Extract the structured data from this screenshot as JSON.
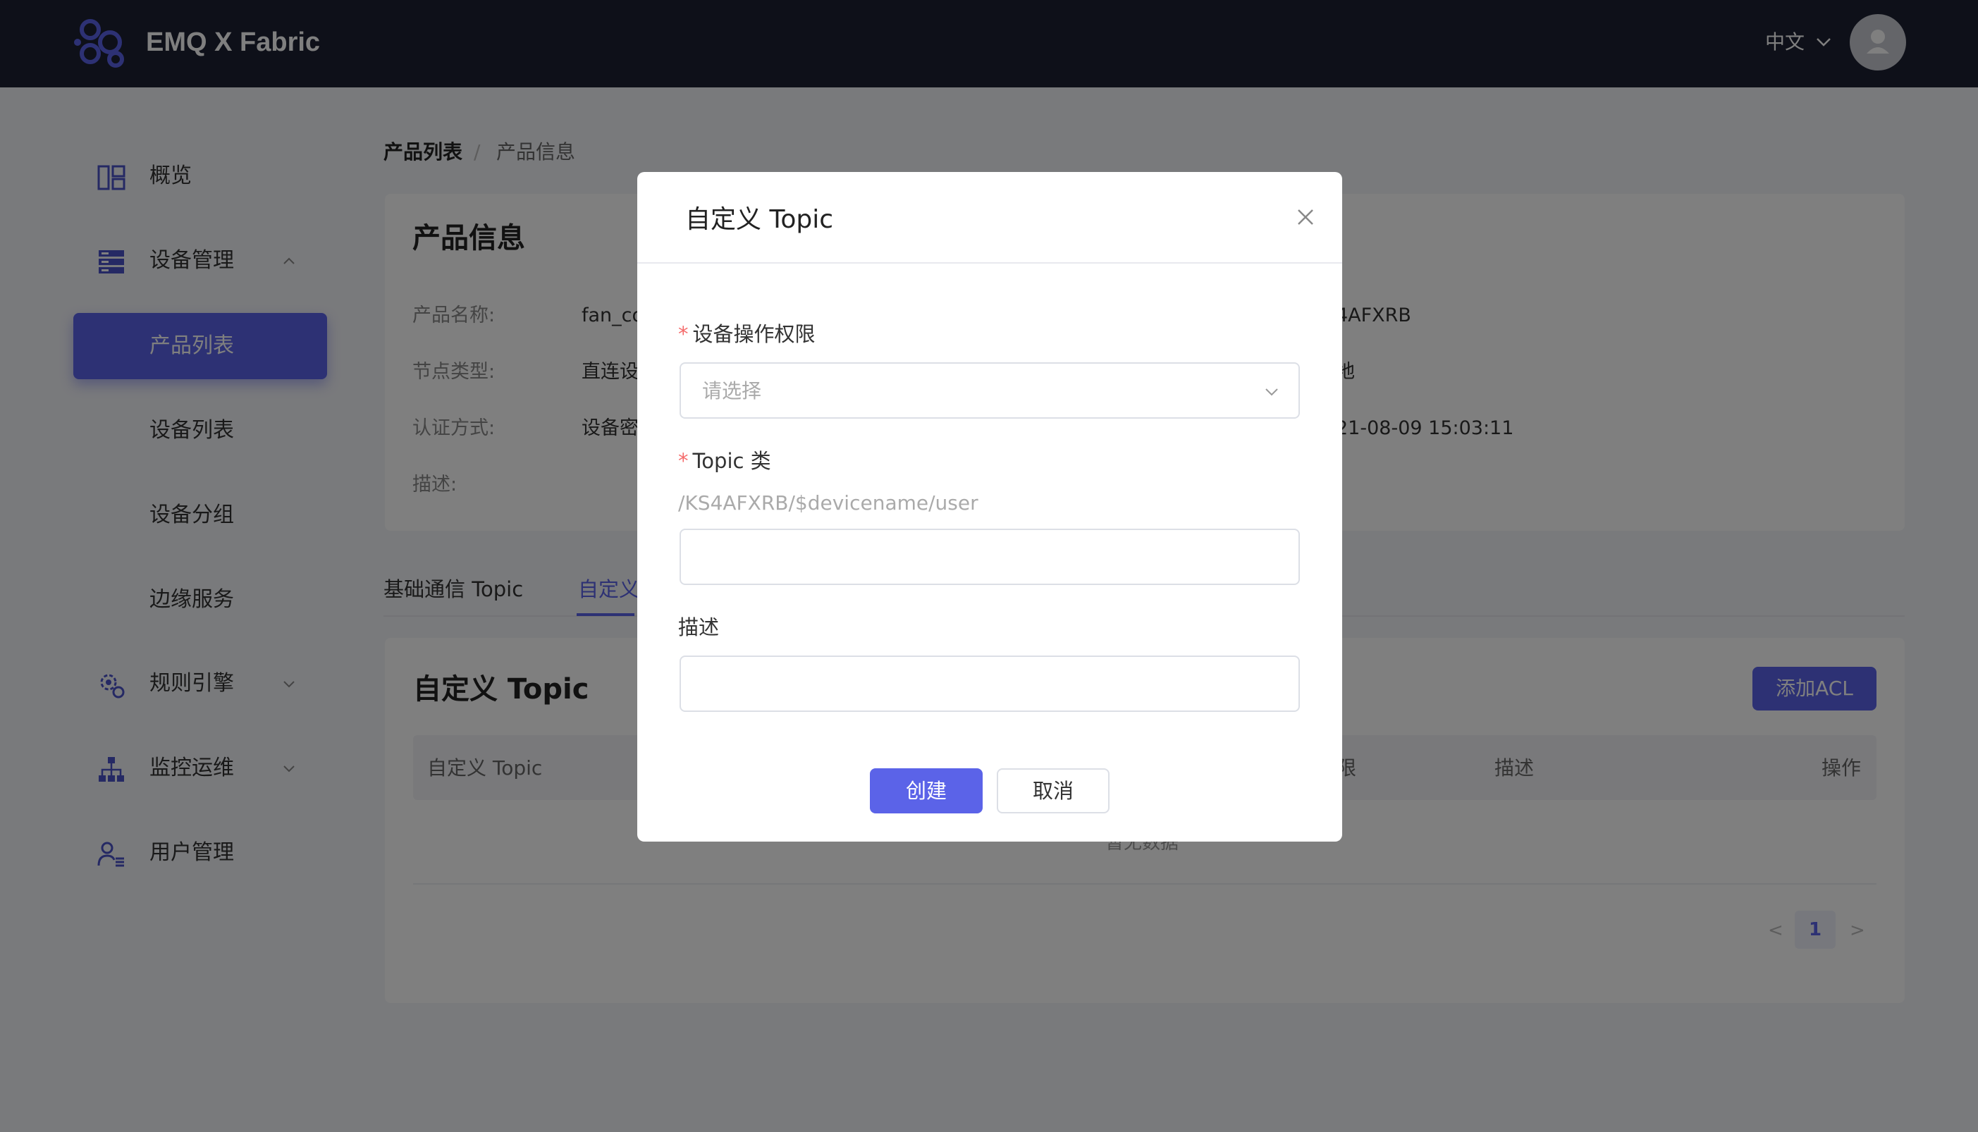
{
  "app": {
    "brand": "EMQ X Fabric",
    "accent_color": "#5b63e8",
    "header_bg": "#1d2133"
  },
  "header": {
    "lang": "中文",
    "avatar_icon": "user-icon"
  },
  "sidebar": {
    "overview": "概览",
    "device_mgmt": "设备管理",
    "sub_items": [
      "产品列表",
      "设备列表",
      "设备分组",
      "边缘服务"
    ],
    "rules": "规则引擎",
    "monitor": "监控运维",
    "users": "用户管理"
  },
  "breadcrumb": {
    "parent": "产品列表",
    "sep": "/",
    "current": "产品信息"
  },
  "product_info": {
    "title": "产品信息",
    "labels": [
      "产品名称:",
      "节点类型:",
      "认证方式:",
      "描述:"
    ],
    "values": [
      "fan_co",
      "直连设",
      "设备密"
    ],
    "right_values": [
      "4AFXRB",
      "地",
      "21-08-09 15:03:11"
    ]
  },
  "tabs": {
    "basic": "基础通信 Topic",
    "custom": "自定义"
  },
  "custom_section": {
    "title": "自定义 Topic",
    "add_button": "添加ACL",
    "columns": [
      "自定义 Topic",
      "限",
      "描述",
      "操作"
    ],
    "empty_text": "暂无数据",
    "pagination": {
      "prev": "<",
      "current": "1",
      "next": ">"
    }
  },
  "modal": {
    "title": "自定义 Topic",
    "permission_label": "设备操作权限",
    "permission_placeholder": "请选择",
    "topic_label": "Topic 类",
    "topic_prefix": "/KS4AFXRB/$devicename/user",
    "topic_value": "",
    "desc_label": "描述",
    "desc_value": "",
    "required_mark": "*",
    "create_button": "创建",
    "cancel_button": "取消"
  }
}
